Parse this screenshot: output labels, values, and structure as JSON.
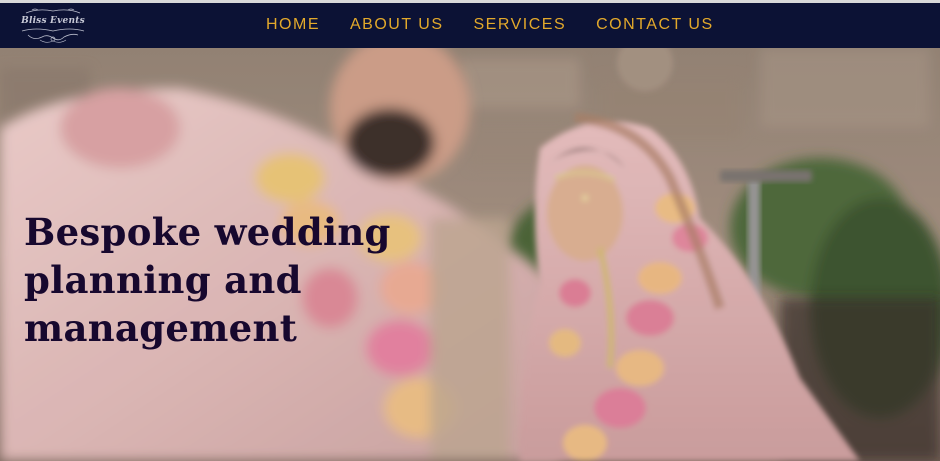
{
  "logo": {
    "text": "Bliss Events"
  },
  "nav": {
    "items": [
      {
        "label": "HOME"
      },
      {
        "label": "ABOUT US"
      },
      {
        "label": "SERVICES"
      },
      {
        "label": "CONTACT US"
      }
    ]
  },
  "hero": {
    "headline": "Bespoke wedding planning and management"
  },
  "colors": {
    "header_bg": "#0c1235",
    "nav_text": "#e3a92b",
    "headline_text": "#17082e"
  }
}
